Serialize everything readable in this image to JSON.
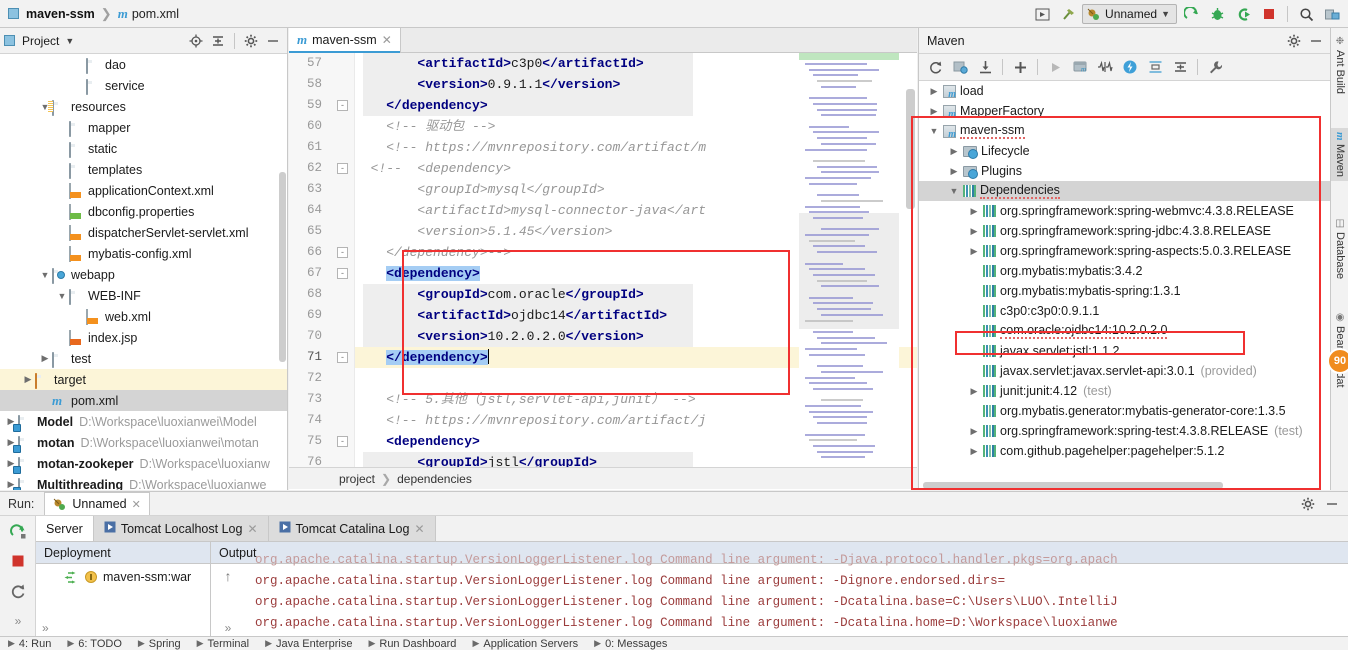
{
  "window": {
    "breadcrumb_project": "maven-ssm",
    "breadcrumb_file": "pom.xml"
  },
  "toolbar": {
    "run_config_name": "Unnamed",
    "icons": [
      "project-structure-icon",
      "build-hammer-icon",
      "run-icon",
      "debug-icon",
      "run-coverage-icon",
      "stop-icon",
      "search-icon",
      "project-structure-settings-icon"
    ]
  },
  "project_panel": {
    "title": "Project",
    "header_icons": [
      "locate-icon",
      "collapse-all-icon",
      "gear-icon",
      "hide-icon"
    ],
    "tree": [
      {
        "indent": 4,
        "label": "dao",
        "icon": "folder",
        "arrow": "",
        "state": ""
      },
      {
        "indent": 4,
        "label": "service",
        "icon": "folder",
        "arrow": "",
        "state": ""
      },
      {
        "indent": 2,
        "label": "resources",
        "icon": "folder-resources",
        "arrow": "v",
        "state": ""
      },
      {
        "indent": 3,
        "label": "mapper",
        "icon": "folder",
        "arrow": "",
        "state": ""
      },
      {
        "indent": 3,
        "label": "static",
        "icon": "folder",
        "arrow": "",
        "state": ""
      },
      {
        "indent": 3,
        "label": "templates",
        "icon": "folder",
        "arrow": "",
        "state": ""
      },
      {
        "indent": 3,
        "label": "applicationContext.xml",
        "icon": "xml-file",
        "arrow": "",
        "state": ""
      },
      {
        "indent": 3,
        "label": "dbconfig.properties",
        "icon": "properties-file",
        "arrow": "",
        "state": ""
      },
      {
        "indent": 3,
        "label": "dispatcherServlet-servlet.xml",
        "icon": "xml-file",
        "arrow": "",
        "state": ""
      },
      {
        "indent": 3,
        "label": "mybatis-config.xml",
        "icon": "xml-file",
        "arrow": "",
        "state": ""
      },
      {
        "indent": 2,
        "label": "webapp",
        "icon": "folder-web",
        "arrow": "v",
        "state": ""
      },
      {
        "indent": 3,
        "label": "WEB-INF",
        "icon": "folder",
        "arrow": "v",
        "state": ""
      },
      {
        "indent": 4,
        "label": "web.xml",
        "icon": "xml-file",
        "arrow": "",
        "state": ""
      },
      {
        "indent": 3,
        "label": "index.jsp",
        "icon": "jsp-file",
        "arrow": "",
        "state": ""
      },
      {
        "indent": 2,
        "label": "test",
        "icon": "folder",
        "arrow": ">",
        "state": ""
      },
      {
        "indent": 1,
        "label": "target",
        "icon": "folder-orange",
        "arrow": ">",
        "state": "selected-yellow"
      },
      {
        "indent": 2,
        "label": "pom.xml",
        "icon": "maven-m",
        "arrow": "",
        "state": "selected-grey"
      },
      {
        "indent": 0,
        "label": "Model",
        "icon": "module",
        "arrow": ">",
        "state": "bold",
        "path": "D:\\Workspace\\luoxianwei\\Model"
      },
      {
        "indent": 0,
        "label": "motan",
        "icon": "module",
        "arrow": ">",
        "state": "bold",
        "path": "D:\\Workspace\\luoxianwei\\motan"
      },
      {
        "indent": 0,
        "label": "motan-zookeper",
        "icon": "module",
        "arrow": ">",
        "state": "bold",
        "path": "D:\\Workspace\\luoxianw"
      },
      {
        "indent": 0,
        "label": "Multithreading",
        "icon": "module",
        "arrow": ">",
        "state": "bold",
        "path": "D:\\Workspace\\luoxianwe"
      }
    ]
  },
  "editor": {
    "tab_label": "maven-ssm",
    "tab_icon": "maven-m",
    "breadcrumb": [
      "project",
      "dependencies"
    ],
    "inspection_status": "ok-check",
    "lines": [
      {
        "num": 57,
        "fold": "",
        "segments": [
          {
            "t": "        ",
            "c": "txt"
          },
          {
            "t": "<artifactId>",
            "c": "kw"
          },
          {
            "t": "c3p0",
            "c": "txt"
          },
          {
            "t": "</artifactId>",
            "c": "kw"
          }
        ],
        "hl": "grey"
      },
      {
        "num": 58,
        "fold": "",
        "segments": [
          {
            "t": "        ",
            "c": "txt"
          },
          {
            "t": "<version>",
            "c": "kw"
          },
          {
            "t": "0.9.1.1",
            "c": "txt"
          },
          {
            "t": "</version>",
            "c": "kw"
          }
        ],
        "hl": "grey"
      },
      {
        "num": 59,
        "fold": "-",
        "segments": [
          {
            "t": "    ",
            "c": "txt"
          },
          {
            "t": "</dependency>",
            "c": "kw"
          }
        ],
        "hl": "grey"
      },
      {
        "num": 60,
        "fold": "",
        "segments": [
          {
            "t": "    <!-- 驱动包 -->",
            "c": "cmt"
          }
        ],
        "hl": ""
      },
      {
        "num": 61,
        "fold": "",
        "segments": [
          {
            "t": "    <!-- https://mvnrepository.com/artifact/m",
            "c": "cmt"
          }
        ],
        "hl": ""
      },
      {
        "num": 62,
        "fold": "-",
        "segments": [
          {
            "t": "  <!--  <dependency>",
            "c": "cmt"
          }
        ],
        "hl": ""
      },
      {
        "num": 63,
        "fold": "",
        "segments": [
          {
            "t": "        <groupId>mysql</groupId>",
            "c": "cmt"
          }
        ],
        "hl": ""
      },
      {
        "num": 64,
        "fold": "",
        "segments": [
          {
            "t": "        <artifactId>mysql-connector-java</art",
            "c": "cmt"
          }
        ],
        "hl": ""
      },
      {
        "num": 65,
        "fold": "",
        "segments": [
          {
            "t": "        <version>5.1.45</version>",
            "c": "cmt"
          }
        ],
        "hl": ""
      },
      {
        "num": 66,
        "fold": "-",
        "segments": [
          {
            "t": "    </dependency>-->",
            "c": "cmt"
          }
        ],
        "hl": ""
      },
      {
        "num": 67,
        "fold": "-",
        "segments": [
          {
            "t": "    ",
            "c": "txt"
          },
          {
            "t": "<dependency>",
            "c": "kw sel"
          }
        ],
        "hl": ""
      },
      {
        "num": 68,
        "fold": "",
        "segments": [
          {
            "t": "        ",
            "c": "txt"
          },
          {
            "t": "<groupId>",
            "c": "kw"
          },
          {
            "t": "com.oracle",
            "c": "txt"
          },
          {
            "t": "</groupId>",
            "c": "kw"
          }
        ],
        "hl": "grey"
      },
      {
        "num": 69,
        "fold": "",
        "segments": [
          {
            "t": "        ",
            "c": "txt"
          },
          {
            "t": "<artifactId>",
            "c": "kw"
          },
          {
            "t": "ojdbc14",
            "c": "txt"
          },
          {
            "t": "</artifactId>",
            "c": "kw"
          }
        ],
        "hl": "grey"
      },
      {
        "num": 70,
        "fold": "",
        "segments": [
          {
            "t": "        ",
            "c": "txt"
          },
          {
            "t": "<version>",
            "c": "kw"
          },
          {
            "t": "10.2.0.2.0",
            "c": "txt"
          },
          {
            "t": "</version>",
            "c": "kw"
          }
        ],
        "hl": "grey"
      },
      {
        "num": 71,
        "fold": "-",
        "segments": [
          {
            "t": "    ",
            "c": "txt"
          },
          {
            "t": "</dependency>",
            "c": "kw sel"
          }
        ],
        "hl": "current"
      },
      {
        "num": 72,
        "fold": "",
        "segments": [],
        "hl": ""
      },
      {
        "num": 73,
        "fold": "",
        "segments": [
          {
            "t": "    <!-- 5.其他（jstl,servlet-api,junit） -->",
            "c": "cmt"
          }
        ],
        "hl": ""
      },
      {
        "num": 74,
        "fold": "",
        "segments": [
          {
            "t": "    <!-- https://mvnrepository.com/artifact/j",
            "c": "cmt"
          }
        ],
        "hl": ""
      },
      {
        "num": 75,
        "fold": "-",
        "segments": [
          {
            "t": "    ",
            "c": "txt"
          },
          {
            "t": "<dependency>",
            "c": "kw"
          }
        ],
        "hl": ""
      },
      {
        "num": 76,
        "fold": "",
        "segments": [
          {
            "t": "        ",
            "c": "txt"
          },
          {
            "t": "<groupId>",
            "c": "kw"
          },
          {
            "t": "jstl",
            "c": "txt"
          },
          {
            "t": "</groupId>",
            "c": "kw"
          }
        ],
        "hl": "grey"
      }
    ]
  },
  "maven_panel": {
    "title": "Maven",
    "header_icons": [
      "gear-icon",
      "hide-icon"
    ],
    "toolbar_icons": [
      "reimport-icon",
      "generate-sources-icon",
      "download-sources-icon",
      "add-icon",
      "run-icon",
      "execute-maven-goal-icon",
      "toggle-offline-icon",
      "toggle-skip-tests-icon",
      "collapse-icon",
      "expand-icon",
      "maven-settings-icon"
    ],
    "tree": [
      {
        "indent": 0,
        "arrow": ">",
        "icon": "maven-project",
        "label": "load",
        "scope": "",
        "state": ""
      },
      {
        "indent": 0,
        "arrow": ">",
        "icon": "maven-project",
        "label": "MapperFactory",
        "scope": "",
        "state": ""
      },
      {
        "indent": 0,
        "arrow": "v",
        "icon": "maven-project",
        "label": "maven-ssm",
        "scope": "",
        "state": "squiggle"
      },
      {
        "indent": 1,
        "arrow": ">",
        "icon": "folder-gear",
        "label": "Lifecycle",
        "scope": "",
        "state": ""
      },
      {
        "indent": 1,
        "arrow": ">",
        "icon": "folder-gear",
        "label": "Plugins",
        "scope": "",
        "state": ""
      },
      {
        "indent": 1,
        "arrow": "v",
        "icon": "bars",
        "label": "Dependencies",
        "scope": "",
        "state": "selected squiggle"
      },
      {
        "indent": 2,
        "arrow": ">",
        "icon": "bars",
        "label": "org.springframework:spring-webmvc:4.3.8.RELEASE",
        "scope": "",
        "state": ""
      },
      {
        "indent": 2,
        "arrow": ">",
        "icon": "bars",
        "label": "org.springframework:spring-jdbc:4.3.8.RELEASE",
        "scope": "",
        "state": ""
      },
      {
        "indent": 2,
        "arrow": ">",
        "icon": "bars",
        "label": "org.springframework:spring-aspects:5.0.3.RELEASE",
        "scope": "",
        "state": ""
      },
      {
        "indent": 2,
        "arrow": "",
        "icon": "bars",
        "label": "org.mybatis:mybatis:3.4.2",
        "scope": "",
        "state": ""
      },
      {
        "indent": 2,
        "arrow": "",
        "icon": "bars",
        "label": "org.mybatis:mybatis-spring:1.3.1",
        "scope": "",
        "state": ""
      },
      {
        "indent": 2,
        "arrow": "",
        "icon": "bars",
        "label": "c3p0:c3p0:0.9.1.1",
        "scope": "",
        "state": ""
      },
      {
        "indent": 2,
        "arrow": "",
        "icon": "bars",
        "label": "com.oracle:ojdbc14:10.2.0.2.0",
        "scope": "",
        "state": "squiggle"
      },
      {
        "indent": 2,
        "arrow": "",
        "icon": "bars",
        "label": "javax.servlet:jstl:1.1.2",
        "scope": "",
        "state": ""
      },
      {
        "indent": 2,
        "arrow": "",
        "icon": "bars",
        "label": "javax.servlet:javax.servlet-api:3.0.1",
        "scope": "(provided)",
        "state": ""
      },
      {
        "indent": 2,
        "arrow": ">",
        "icon": "bars",
        "label": "junit:junit:4.12",
        "scope": "(test)",
        "state": ""
      },
      {
        "indent": 2,
        "arrow": "",
        "icon": "bars",
        "label": "org.mybatis.generator:mybatis-generator-core:1.3.5",
        "scope": "",
        "state": ""
      },
      {
        "indent": 2,
        "arrow": ">",
        "icon": "bars",
        "label": "org.springframework:spring-test:4.3.8.RELEASE",
        "scope": "(test)",
        "state": ""
      },
      {
        "indent": 2,
        "arrow": ">",
        "icon": "bars",
        "label": "com.github.pagehelper:pagehelper:5.1.2",
        "scope": "",
        "state": ""
      }
    ]
  },
  "right_sidebar": {
    "items": [
      {
        "label": "Ant Build",
        "icon": "ant-icon",
        "active": false
      },
      {
        "label": "Maven",
        "icon": "maven-m-icon",
        "active": true
      },
      {
        "label": "Database",
        "icon": "database-icon",
        "active": false
      },
      {
        "label": "Bean Validat",
        "icon": "bean-validation-icon",
        "active": false
      }
    ],
    "badge": "90"
  },
  "run_panel": {
    "run_label": "Run:",
    "run_tab": "Unnamed",
    "sub_tabs": [
      {
        "label": "Server",
        "active": true,
        "closable": false
      },
      {
        "label": "Tomcat Localhost Log",
        "active": false,
        "closable": true
      },
      {
        "label": "Tomcat Catalina Log",
        "active": false,
        "closable": true
      }
    ],
    "deployment_header": "Deployment",
    "output_header": "Output",
    "deployment_item": "maven-ssm:war",
    "output_lines": [
      "in] org.apache.catalina.startup.VersionLoggerListener.log Command line argument: -Djava.protocol.handler.pkgs=org.apach",
      "in] org.apache.catalina.startup.VersionLoggerListener.log Command line argument: -Dignore.endorsed.dirs=",
      "in] org.apache.catalina.startup.VersionLoggerListener.log Command line argument: -Dcatalina.base=C:\\Users\\LUO\\.IntelliJ",
      "in] org.apache.catalina.startup.VersionLoggerListener.log Command line argument: -Dcatalina.home=D:\\Workspace\\luoxianwe"
    ]
  },
  "status_bar": {
    "items": [
      {
        "label": "4: Run",
        "icon": "run-icon"
      },
      {
        "label": "6: TODO",
        "icon": "todo-icon"
      },
      {
        "label": "Spring",
        "icon": "spring-icon"
      },
      {
        "label": "Terminal",
        "icon": "terminal-icon"
      },
      {
        "label": "Java Enterprise",
        "icon": "java-ee-icon"
      },
      {
        "label": "Run Dashboard",
        "icon": "dashboard-icon"
      },
      {
        "label": "Application Servers",
        "icon": "server-icon"
      },
      {
        "label": "0: Messages",
        "icon": "messages-icon"
      }
    ]
  },
  "colors": {
    "accent_blue": "#3b9bd4",
    "highlight_red": "#f03030",
    "selection_blue": "#a5cdf4",
    "current_line_yellow": "#fcf5d8"
  }
}
